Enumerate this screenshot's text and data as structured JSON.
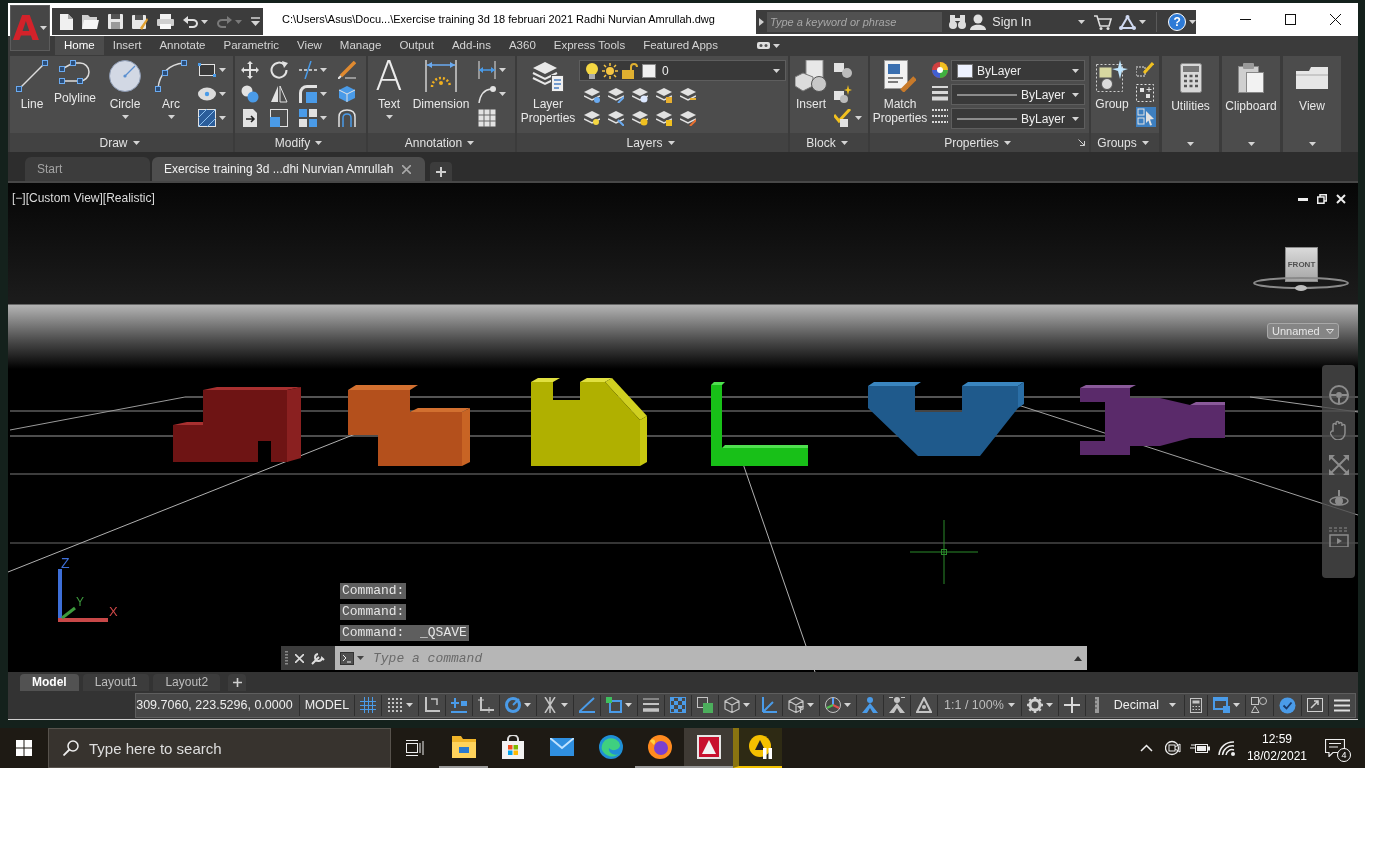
{
  "title_bar": {
    "app_glyph": "A",
    "title": "C:\\Users\\Asus\\Docu...\\Exercise training 3d 18 februari 2021 Radhi Nurvian Amrullah.dwg",
    "search": {
      "placeholder": "Type a keyword or phrase"
    },
    "sign_in": "Sign In",
    "help": "?"
  },
  "ribbon_tabs": [
    {
      "label": "Home",
      "selected": true
    },
    {
      "label": "Insert",
      "selected": false
    },
    {
      "label": "Annotate",
      "selected": false
    },
    {
      "label": "Parametric",
      "selected": false
    },
    {
      "label": "View",
      "selected": false
    },
    {
      "label": "Manage",
      "selected": false
    },
    {
      "label": "Output",
      "selected": false
    },
    {
      "label": "Add-ins",
      "selected": false
    },
    {
      "label": "A360",
      "selected": false
    },
    {
      "label": "Express Tools",
      "selected": false
    },
    {
      "label": "Featured Apps",
      "selected": false
    }
  ],
  "ribbon_panels": [
    {
      "title": "Draw",
      "tools": [
        {
          "label": "Line",
          "dropdown": false
        },
        {
          "label": "Polyline",
          "dropdown": false
        },
        {
          "label": "Circle",
          "dropdown": true
        },
        {
          "label": "Arc",
          "dropdown": true
        }
      ]
    },
    {
      "title": "Modify"
    },
    {
      "title": "Annotation",
      "tools": [
        {
          "label": "Text",
          "glyph": "A",
          "dropdown": true
        },
        {
          "label": "Dimension",
          "dropdown": false
        }
      ]
    },
    {
      "title": "Layers",
      "tools": [
        {
          "label": "Layer Properties",
          "dropdown": false
        }
      ],
      "current_layer": "0"
    },
    {
      "title": "Block",
      "tools": [
        {
          "label": "Insert",
          "dropdown": false
        }
      ]
    },
    {
      "title": "Properties",
      "tools": [
        {
          "label": "Match Properties",
          "dropdown": false
        }
      ],
      "color_setting": "ByLayer",
      "lineweight_setting": "ByLayer",
      "linetype_setting": "ByLayer"
    },
    {
      "title": "Groups",
      "tools": [
        {
          "label": "Group",
          "dropdown": false
        }
      ],
      "group_selection_on": true
    }
  ],
  "collapsed_panels": [
    {
      "label": "Utilities"
    },
    {
      "label": "Clipboard"
    },
    {
      "label": "View"
    }
  ],
  "file_tabs": [
    {
      "label": "Start",
      "selected": false
    },
    {
      "label": "Exercise training 3d ...dhi Nurvian Amrullah",
      "selected": true
    }
  ],
  "viewport": {
    "label": "[−][Custom View][Realistic]",
    "view_cube": "FRONT",
    "visual_style": "Unnamed",
    "ucs_axes": {
      "z": "Z",
      "y": "Y",
      "x": "X"
    }
  },
  "command_history": [
    "Command:",
    "Command:",
    "Command:  _QSAVE"
  ],
  "command_line": {
    "placeholder": "Type a command"
  },
  "layout_tabs": [
    {
      "label": "Model",
      "selected": true
    },
    {
      "label": "Layout1",
      "selected": false
    },
    {
      "label": "Layout2",
      "selected": false
    }
  ],
  "status_bar": {
    "coordinates": "309.7060, 223.5296, 0.0000",
    "space": "MODEL",
    "toggles": [
      {
        "on": true
      },
      {
        "on": false
      },
      {
        "on": false
      },
      {
        "on": true
      },
      {
        "on": false
      },
      {
        "on": true
      },
      {
        "on": false
      },
      {
        "on": true
      },
      {
        "on": true
      },
      {
        "on": false
      },
      {
        "on": true
      },
      {
        "on": false
      },
      {
        "on": false
      },
      {
        "on": true
      },
      {
        "on": false
      },
      {
        "on": false
      },
      {
        "on": true
      },
      {
        "on": false
      },
      {
        "on": false
      }
    ],
    "annotation_scale": "1:1 / 100%",
    "units": "Decimal",
    "right_toggles": [
      {
        "on": true
      },
      {
        "on": false
      },
      {
        "on": true
      }
    ]
  },
  "taskbar": {
    "search": {
      "placeholder": "Type here to search"
    },
    "apps": [
      {
        "running": true,
        "focused": false,
        "flashing": false
      },
      {
        "running": false,
        "focused": false,
        "flashing": false
      },
      {
        "running": false,
        "focused": false,
        "flashing": false
      },
      {
        "running": false,
        "focused": false,
        "flashing": false
      },
      {
        "running": true,
        "focused": false,
        "flashing": false
      },
      {
        "running": true,
        "focused": true,
        "flashing": false
      },
      {
        "running": true,
        "focused": false,
        "flashing": true
      }
    ],
    "time": "12:59",
    "date": "18/02/2021",
    "notifications": "4"
  }
}
